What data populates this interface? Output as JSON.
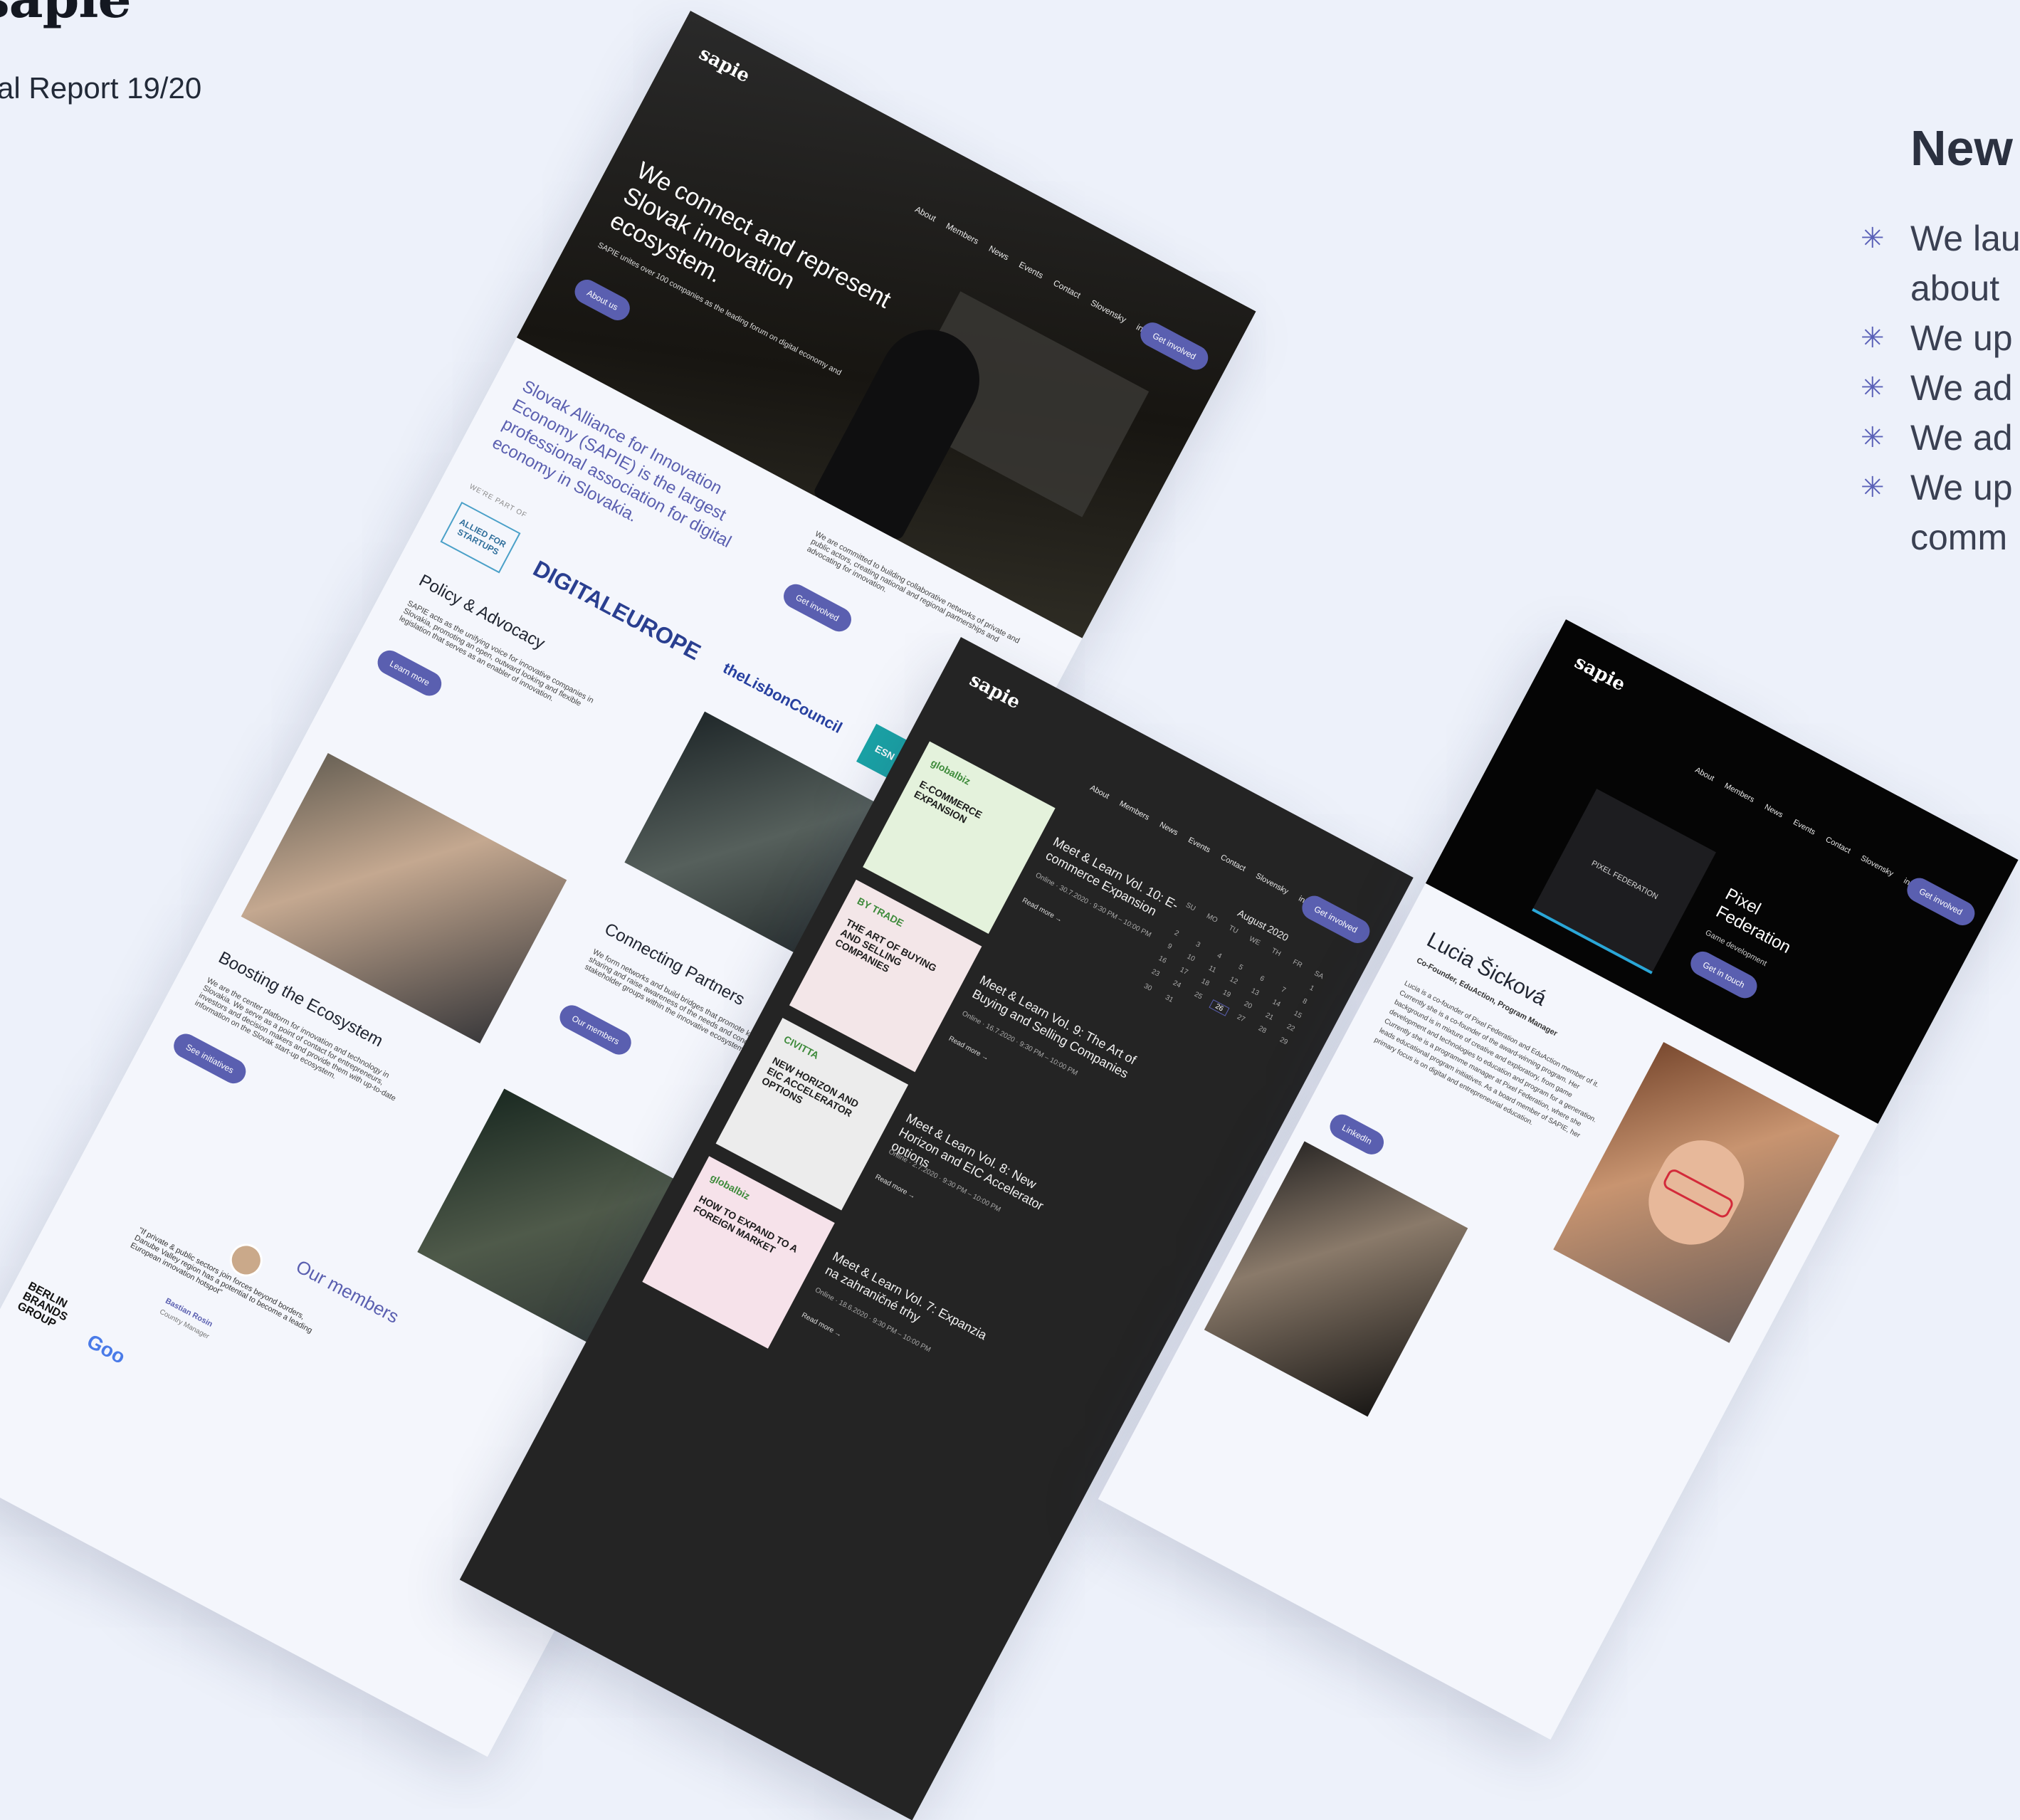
{
  "left_crop": {
    "brand": "sapie",
    "report": "al Report 19/20"
  },
  "news": {
    "title": "New",
    "items": [
      {
        "lines": [
          "We lau",
          "about"
        ]
      },
      {
        "lines": [
          "We up"
        ]
      },
      {
        "lines": [
          "We ad"
        ]
      },
      {
        "lines": [
          "We ad"
        ]
      },
      {
        "lines": [
          "We up",
          "comm"
        ]
      }
    ],
    "bullet_icon": "sparkle-star-icon"
  },
  "nav": {
    "items": [
      "About",
      "Members",
      "News",
      "Events",
      "Contact",
      "Slovensky"
    ],
    "social": [
      "in",
      "f"
    ],
    "cta": "Get involved"
  },
  "page_home": {
    "logo": "sapie",
    "hero_title": "We connect and represent Slovak innovation ecosystem.",
    "hero_sub": "SAPIE unites over 100 companies as the leading forum on digital economy and",
    "about_btn": "About us",
    "intro": "Slovak Alliance for Innovation Economy (SAPIE) is the largest professional association for digital economy in Slovakia.",
    "committed": "We are committed to building collaborative networks of private and public actors, creating national and regional partnerships and advocating for innovation.",
    "committed_btn": "Get involved",
    "part_of": "WE'RE PART OF",
    "partners": [
      "ALLIED FOR STARTUPS",
      "DIGITALEUROPE",
      "theLisbonCouncil",
      "ESN"
    ],
    "policy_title": "Policy & Advocacy",
    "policy_text": "SAPIE acts as the unifying voice for innovative companies in Slovakia, promoting an open, outward looking and flexible legislation that serves as an enabler of innovation.",
    "learn_btn": "Learn more",
    "connect_title": "Connecting Partners",
    "connect_text": "We form networks and build bridges that promote knowledge-sharing and raise awareness of the needs and concerns of all stakeholder groups within the innovative ecosystem.",
    "members_btn": "Our members",
    "boost_title": "Boosting the Ecosystem",
    "boost_text": "We are the center platform for innovation and technology in Slovakia. We serve as a point of contact for entrepreneurs, investors and decision makers and provide them with up-to-date information on the Slovak start-up ecosystem.",
    "init_btn": "See initiatives",
    "our_members": "Our members",
    "quote": "\"If private & public sectors join forces beyond borders, Danube Valley region has a potential to become a leading European innovation hotspot\"",
    "quote_name": "Bastian Rosin",
    "quote_role": "Country Manager",
    "berlin": "BERLIN BRANDS GROUP",
    "google": "Goo"
  },
  "page_events": {
    "logo": "sapie",
    "events": [
      {
        "brand": "globalbiz",
        "thumb": "E-COMMERCE EXPANSION",
        "title": "Meet & Learn Vol. 10: E-commerce Expansion",
        "meta": "Online · 30.7.2020 · 9:30 PM – 10:00 PM",
        "more": "Read more →",
        "color": "#e4f2dc"
      },
      {
        "brand": "BY TRADE",
        "thumb": "THE ART OF BUYING AND SELLING COMPANIES",
        "title": "Meet & Learn Vol. 9: The Art of Buying and Selling Companies",
        "meta": "Online · 16.7.2020 · 9:30 PM – 10:00 PM",
        "more": "Read more →",
        "color": "#f3e6e8"
      },
      {
        "brand": "CIVITTA",
        "thumb": "NEW HORIZON AND EIC ACCELERATOR OPTIONS",
        "title": "Meet & Learn Vol. 8: New Horizon and EIC Accelerator options",
        "meta": "Online · 2.7.2020 · 9:30 PM – 10:00 PM",
        "more": "Read more →",
        "color": "#ececec"
      },
      {
        "brand": "globalbiz",
        "thumb": "HOW TO EXPAND TO A FOREIGN MARKET",
        "title": "Meet & Learn Vol. 7: Expanzia na zahraničné trhy",
        "meta": "Online · 18.6.2020 · 9:30 PM – 10:00 PM",
        "more": "Read more →",
        "color": "#f6e2ea"
      }
    ],
    "calendar": {
      "month": "August 2020",
      "days_header": [
        "SU",
        "MO",
        "TU",
        "WE",
        "TH",
        "FR",
        "SA"
      ],
      "days": [
        "",
        "",
        "",
        "",
        "",
        "",
        "1",
        "2",
        "3",
        "4",
        "5",
        "6",
        "7",
        "8",
        "9",
        "10",
        "11",
        "12",
        "13",
        "14",
        "15",
        "16",
        "17",
        "18",
        "19",
        "20",
        "21",
        "22",
        "23",
        "24",
        "25",
        "26",
        "27",
        "28",
        "29",
        "30",
        "31"
      ],
      "highlight": "26"
    }
  },
  "page_member": {
    "logo": "sapie",
    "company_logo": "PIXEL FEDERATION",
    "company_name": "Pixel Federation",
    "company_role": "Game development",
    "company_btn": "Get in touch",
    "person_name": "Lucia Šicková",
    "person_role": "Co-Founder, EduAction, Program Manager",
    "bio": "Lucia is a co-founder of Pixel Federation and EduAction member of it. Currently she is a co-founder of the award-winning program. Her background is in mixture of creative and exploratory, from game development and technologies to education and program for a generation. Currently she is a programme manager at Pixel Federation, where she leads educational program initiatives. As a board member of SAPIE, her primary focus is on digital and entrepreneurial education.",
    "linkedin_btn": "LinkedIn"
  },
  "colors": {
    "background": "#edf1fa",
    "accent": "#5a5fb0",
    "dark_page": "#242424",
    "black_header": "#050505"
  }
}
